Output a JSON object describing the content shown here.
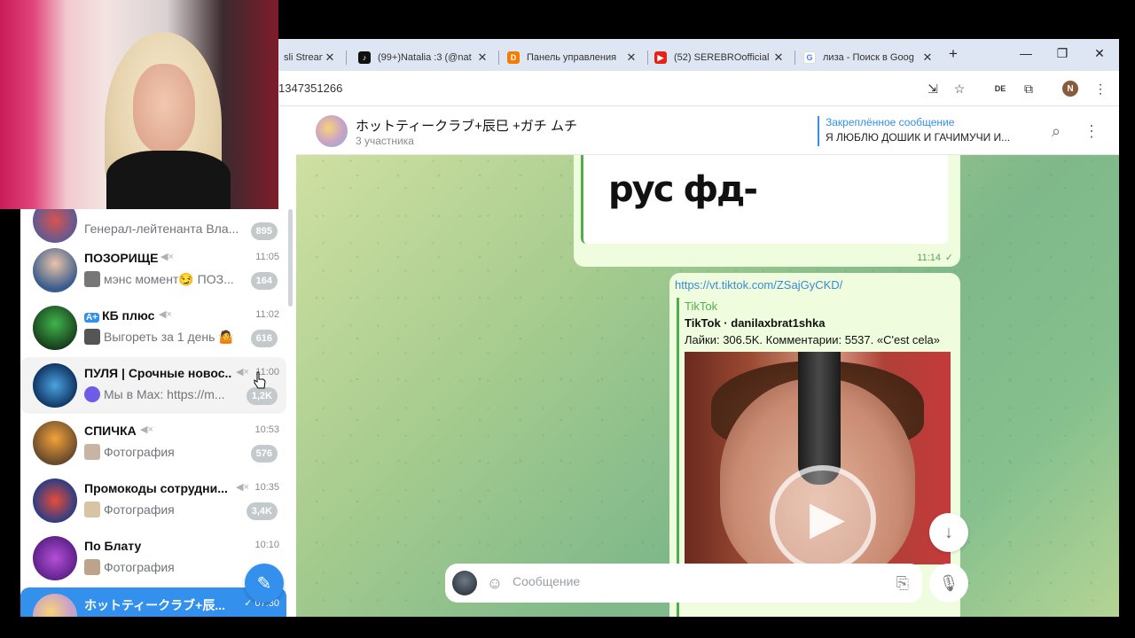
{
  "browser": {
    "tabs": [
      {
        "title": "sli Strean",
        "icon": "stream-icon",
        "icon_color": "#8b5cf6"
      },
      {
        "title": "(99+)Natalia :3 (@nat",
        "icon": "tiktok-icon",
        "icon_color": "#111111"
      },
      {
        "title": "Панель управления",
        "icon": "donationalerts-icon",
        "icon_color": "#f57c00"
      },
      {
        "title": "(52) SEREBROofficial",
        "icon": "youtube-icon",
        "icon_color": "#e62117"
      },
      {
        "title": "лиза - Поиск в Goog",
        "icon": "google-icon",
        "icon_color": "#4285f4"
      }
    ],
    "new_tab": "+",
    "url": "1347351266",
    "profile_initial": "N",
    "translate_badge": "DE"
  },
  "chat": {
    "title": "ホットティークラブ+辰巳 +ガチ ムチ",
    "subtitle": "3 участника",
    "pinned_title": "Закреплённое сообщение",
    "pinned_text": "Я ЛЮБЛЮ ДОШИК И ГАЧИМУЧИ И...",
    "messages": {
      "m1_text": "рус фд-",
      "m1_time": "11:14",
      "m1_check": "✓",
      "m2_link": "https://vt.tiktok.com/ZSajGyCKD/",
      "preview_site": "TikTok",
      "preview_title": "TikTok · danilaxbrat1shka",
      "preview_desc": "Лайки: 306.5K. Комментарии: 5537. «C'est cela»"
    },
    "composer_placeholder": "Сообщение"
  },
  "sidebar": {
    "items": [
      {
        "name": "",
        "preview": "Генерал-лейтенанта Вла...",
        "time": "",
        "badge": "895",
        "muted": false
      },
      {
        "name": "ПОЗОРИЩЕ",
        "preview": "мэнс момент😏 ПОЗ...",
        "time": "11:05",
        "badge": "164",
        "muted": true
      },
      {
        "name": "КБ плюс",
        "preview": "Выгореть за 1 день 🤷",
        "time": "11:02",
        "badge": "616",
        "muted": true
      },
      {
        "name": "ПУЛЯ | Срочные новос...",
        "preview": "Мы в Max: https://m...",
        "time": "11:00",
        "badge": "1,2K",
        "muted": true
      },
      {
        "name": "СПИЧКА",
        "preview": "Фотография",
        "time": "10:53",
        "badge": "576",
        "muted": true
      },
      {
        "name": "Промокоды сотрудни...",
        "preview": "Фотография",
        "time": "10:35",
        "badge": "3,4K",
        "muted": true
      },
      {
        "name": "По Блату",
        "preview": "Фотография",
        "time": "10:10",
        "badge": "",
        "muted": false
      },
      {
        "name": "ホットティークラブ+辰...",
        "preview": "",
        "time": "✓ 07:30",
        "badge": "",
        "muted": false
      }
    ]
  }
}
